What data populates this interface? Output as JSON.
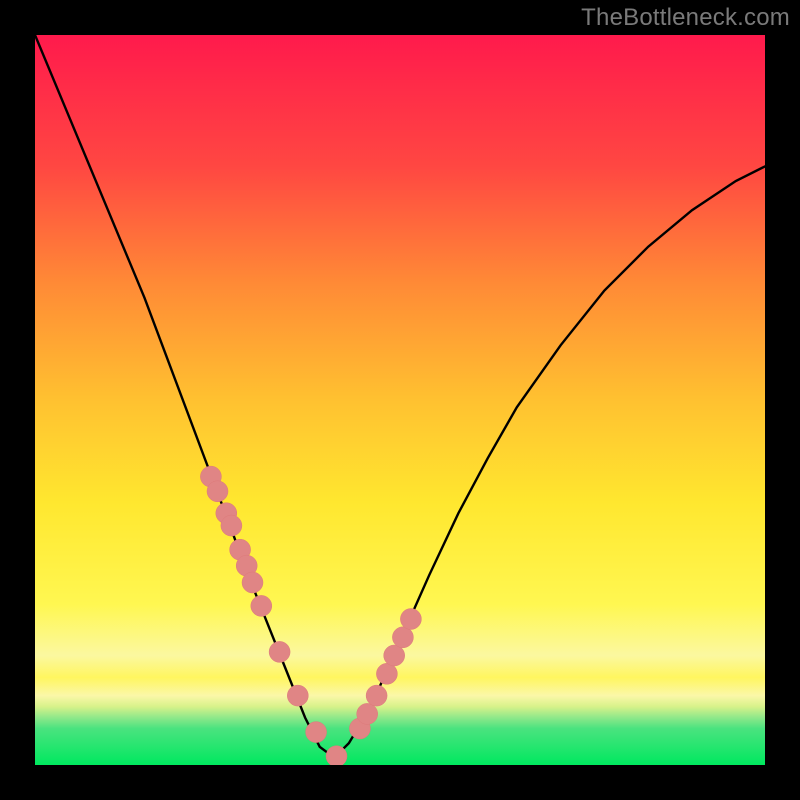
{
  "watermark_text": "TheBottleneck.com",
  "colors": {
    "frame": "#000000",
    "gradient_top": "#ff1a4c",
    "gradient_orange": "#ff7a36",
    "gradient_yellow_mid": "#ffd92f",
    "gradient_cream": "#faf7a0",
    "gradient_band_yellow": "#fff04a",
    "gradient_band_cream": "#fdf6b0",
    "gradient_band_teal": "#4edf9a",
    "gradient_green": "#00e85f",
    "curve": "#000000",
    "dot_fill": "#e08585",
    "dot_stroke": "#de7a7a"
  },
  "chart_data": {
    "type": "line",
    "title": "",
    "xlabel": "",
    "ylabel": "",
    "xlim": [
      0,
      1
    ],
    "ylim": [
      0,
      1
    ],
    "series": [
      {
        "name": "bottleneck-curve",
        "x": [
          0.0,
          0.05,
          0.1,
          0.15,
          0.18,
          0.21,
          0.24,
          0.27,
          0.29,
          0.31,
          0.33,
          0.35,
          0.37,
          0.39,
          0.41,
          0.43,
          0.46,
          0.5,
          0.54,
          0.58,
          0.62,
          0.66,
          0.72,
          0.78,
          0.84,
          0.9,
          0.96,
          1.0
        ],
        "y": [
          1.0,
          0.88,
          0.76,
          0.64,
          0.56,
          0.48,
          0.4,
          0.32,
          0.265,
          0.215,
          0.165,
          0.115,
          0.065,
          0.025,
          0.01,
          0.03,
          0.08,
          0.17,
          0.26,
          0.345,
          0.42,
          0.49,
          0.575,
          0.65,
          0.71,
          0.76,
          0.8,
          0.82
        ]
      }
    ],
    "markers": {
      "name": "sample-points",
      "x": [
        0.241,
        0.25,
        0.262,
        0.269,
        0.281,
        0.29,
        0.298,
        0.31,
        0.335,
        0.36,
        0.385,
        0.413,
        0.445,
        0.455,
        0.468,
        0.482,
        0.492,
        0.504,
        0.515
      ],
      "y": [
        0.395,
        0.375,
        0.345,
        0.328,
        0.295,
        0.273,
        0.25,
        0.218,
        0.155,
        0.095,
        0.045,
        0.012,
        0.05,
        0.07,
        0.095,
        0.125,
        0.15,
        0.175,
        0.2
      ]
    }
  }
}
